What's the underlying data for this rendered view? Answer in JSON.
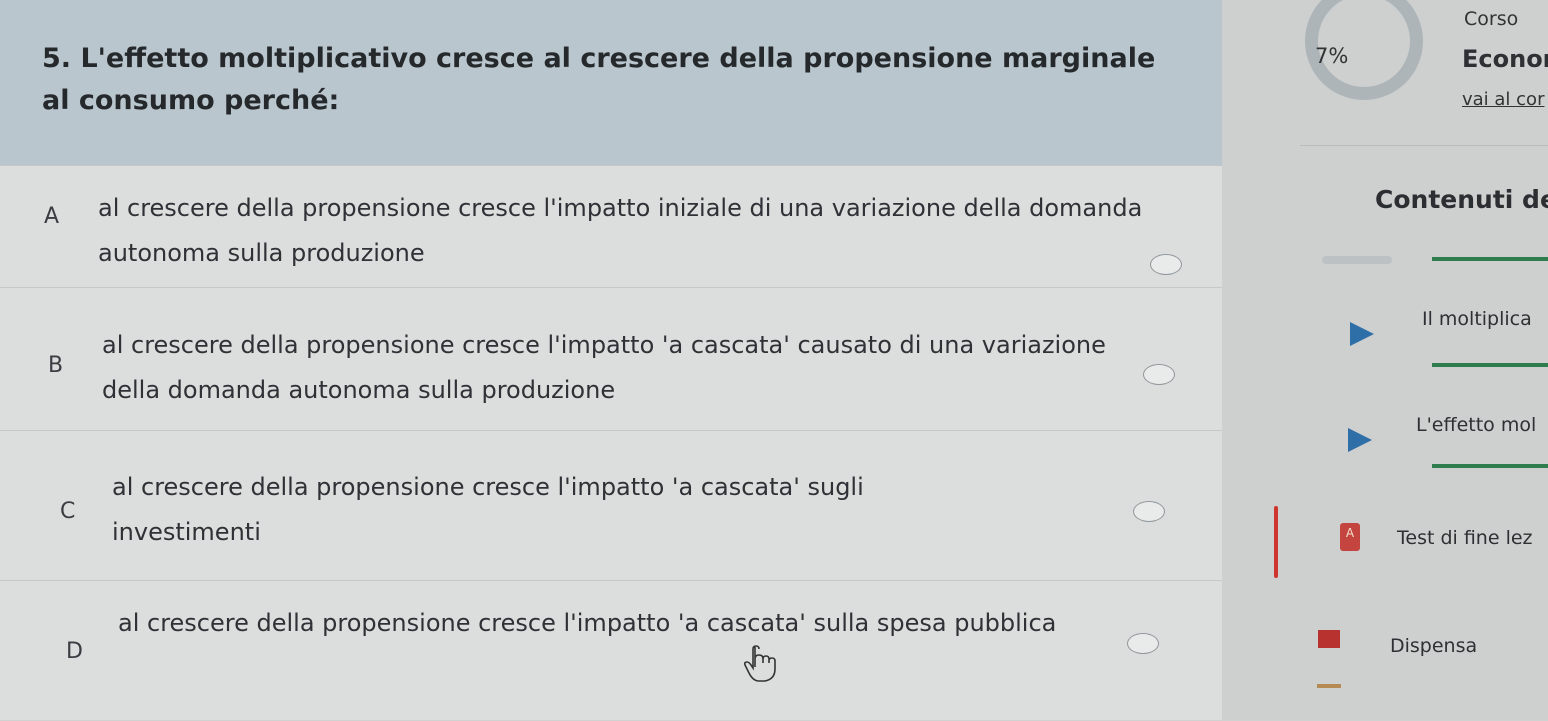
{
  "question": {
    "text": "5. L'effetto moltiplicativo cresce al crescere della propensione marginale al consumo perché:"
  },
  "options": [
    {
      "letter": "A",
      "text": "al crescere della propensione cresce l'impatto iniziale di una variazione della domanda autonoma sulla produzione"
    },
    {
      "letter": "B",
      "text": "al crescere della propensione cresce l'impatto 'a cascata' causato di una variazione della domanda autonoma sulla produzione"
    },
    {
      "letter": "C",
      "text": "al crescere della propensione cresce l'impatto 'a cascata' sugli investimenti"
    },
    {
      "letter": "D",
      "text": "al crescere della propensione cresce l'impatto 'a cascata' sulla spesa pubblica"
    }
  ],
  "sidebar": {
    "corso_label": "Corso",
    "progress_pct": "7%",
    "progress_value": 7,
    "course_name": "Econor",
    "course_link": "vai al cor",
    "contents_title": "Contenuti del Cor",
    "lessons": [
      {
        "label": "Il moltiplica",
        "icon": "play-icon"
      },
      {
        "label": "L'effetto mol",
        "icon": "play-icon"
      },
      {
        "label": "Test di fine lez",
        "icon": "test-icon"
      },
      {
        "label": "Dispensa",
        "icon": "document-icon"
      }
    ],
    "colors": {
      "accent_green": "#2f7d4f",
      "play_blue": "#2f6fa8",
      "test_red": "#c4453f"
    }
  }
}
